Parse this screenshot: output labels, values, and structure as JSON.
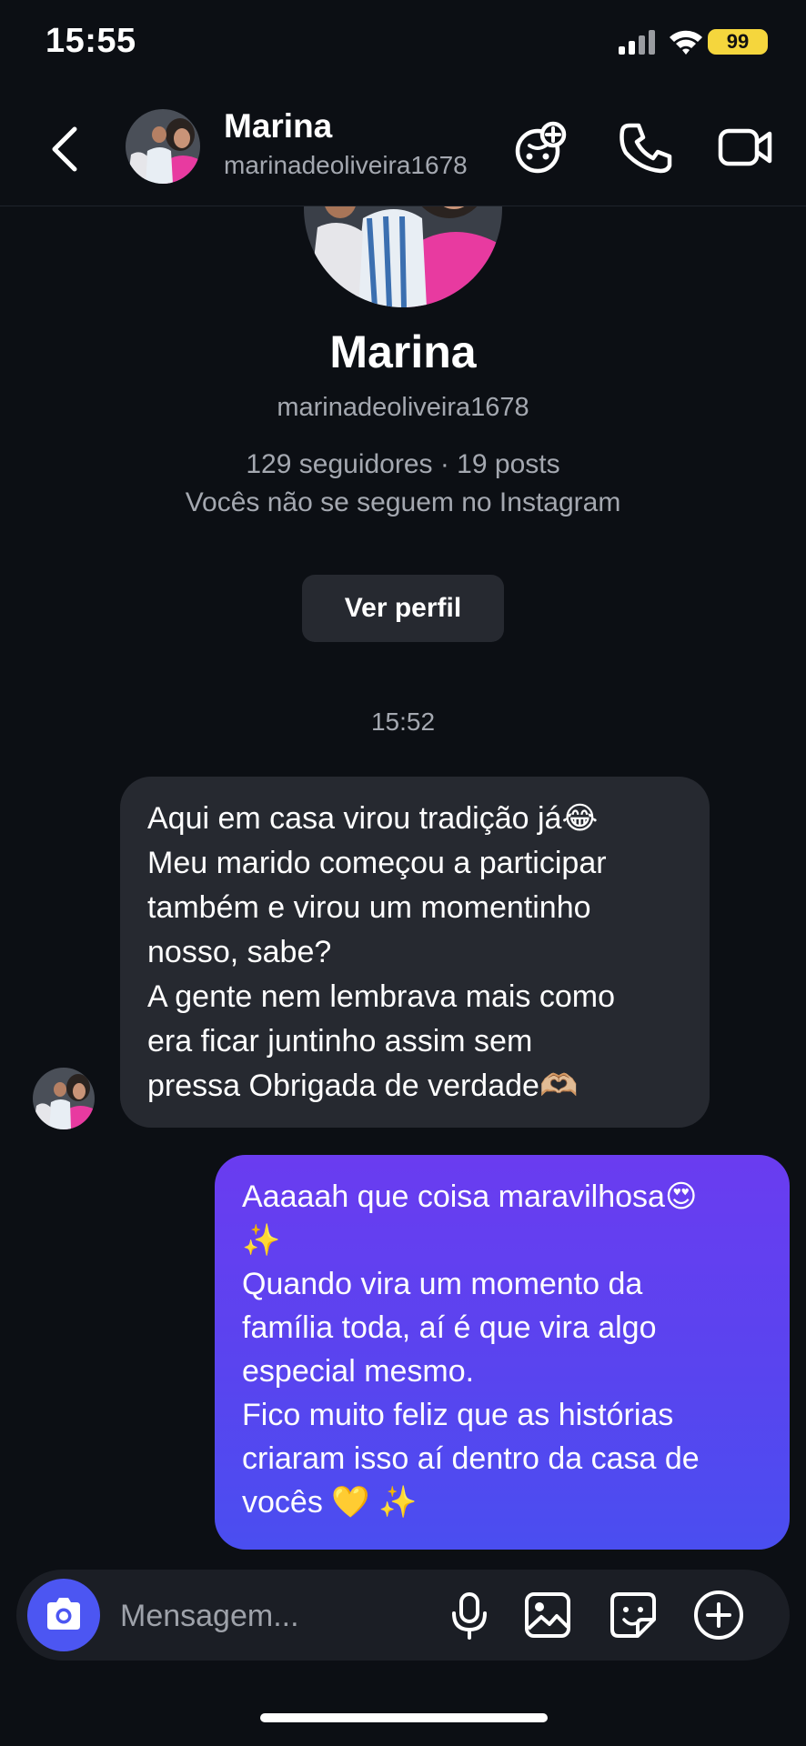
{
  "status_bar": {
    "time": "15:55",
    "battery": "99"
  },
  "header": {
    "name": "Marina",
    "username": "marinadeoliveira1678",
    "icons": [
      "back-arrow-icon",
      "game-controller-icon",
      "phone-icon",
      "video-camera-icon"
    ]
  },
  "profile": {
    "name": "Marina",
    "username": "marinadeoliveira1678",
    "stats": "129 seguidores · 19 posts",
    "follow_status": "Vocês não se seguem no Instagram",
    "view_profile_label": "Ver perfil"
  },
  "conversation": {
    "timestamp": "15:52",
    "messages": [
      {
        "direction": "incoming",
        "text": "Aqui em casa virou tradição já😂\nMeu marido começou a participar\ntambém e virou um momentinho\nnosso, sabe?\nA gente nem lembrava mais como\nera ficar juntinho assim sem\npressa Obrigada de verdade🫶🏼"
      },
      {
        "direction": "outgoing",
        "text": "Aaaaah que coisa maravilhosa😍\n✨\nQuando vira um momento da\nfamília toda, aí é que vira algo\nespecial mesmo.\nFico muito feliz que as histórias\ncriaram isso aí dentro da casa de\nvocês 💛 ✨"
      }
    ]
  },
  "composer": {
    "placeholder": "Mensagem...",
    "icons": [
      "camera-icon",
      "microphone-icon",
      "gallery-icon",
      "sticker-icon",
      "plus-icon"
    ]
  },
  "colors": {
    "background": "#0c0f14",
    "incoming_bubble": "#262930",
    "outgoing_bubble_top": "#6a3cf0",
    "outgoing_bubble_bottom": "#4a4ef0",
    "camera_button": "#4c56f2",
    "battery": "#f5d63d"
  }
}
